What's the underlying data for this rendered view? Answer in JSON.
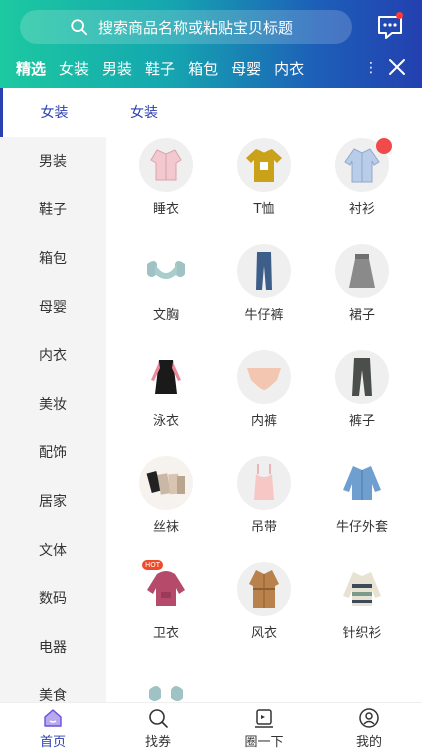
{
  "header": {
    "search_placeholder": "搜索商品名称或粘贴宝贝标题",
    "tabs": [
      "精选",
      "女装",
      "男装",
      "鞋子",
      "箱包",
      "母婴",
      "内衣"
    ],
    "more": "⋮"
  },
  "sidebar": {
    "items": [
      "女装",
      "男装",
      "鞋子",
      "箱包",
      "母婴",
      "内衣",
      "美妆",
      "配饰",
      "居家",
      "文体",
      "数码",
      "电器",
      "美食"
    ],
    "active_index": 0
  },
  "main": {
    "section_title": "女装",
    "categories": [
      {
        "label": "睡衣",
        "icon": "pajamas-icon"
      },
      {
        "label": "T恤",
        "icon": "tshirt-icon"
      },
      {
        "label": "衬衫",
        "icon": "shirt-icon",
        "badge": "fire"
      },
      {
        "label": "文胸",
        "icon": "bra-icon"
      },
      {
        "label": "牛仔裤",
        "icon": "jeans-icon"
      },
      {
        "label": "裙子",
        "icon": "skirt-icon"
      },
      {
        "label": "泳衣",
        "icon": "swimsuit-icon"
      },
      {
        "label": "内裤",
        "icon": "underwear-icon"
      },
      {
        "label": "裤子",
        "icon": "pants-icon"
      },
      {
        "label": "丝袜",
        "icon": "stockings-icon"
      },
      {
        "label": "吊带",
        "icon": "camisole-icon"
      },
      {
        "label": "牛仔外套",
        "icon": "denim-jacket-icon"
      },
      {
        "label": "卫衣",
        "icon": "hoodie-icon",
        "badge": "HOT"
      },
      {
        "label": "风衣",
        "icon": "trench-coat-icon"
      },
      {
        "label": "针织衫",
        "icon": "cardigan-icon"
      },
      {
        "label": "",
        "icon": "lingerie-set-icon"
      }
    ]
  },
  "bottom_nav": {
    "items": [
      {
        "label": "首页",
        "icon": "home-icon",
        "active": true
      },
      {
        "label": "找券",
        "icon": "search-icon"
      },
      {
        "label": "圈一下",
        "icon": "share-icon"
      },
      {
        "label": "我的",
        "icon": "profile-icon"
      }
    ]
  },
  "colors": {
    "accent": "#2a3fb0",
    "header_start": "#1cc9a0",
    "header_end": "#2340b0",
    "badge_red": "#f04a4a"
  }
}
